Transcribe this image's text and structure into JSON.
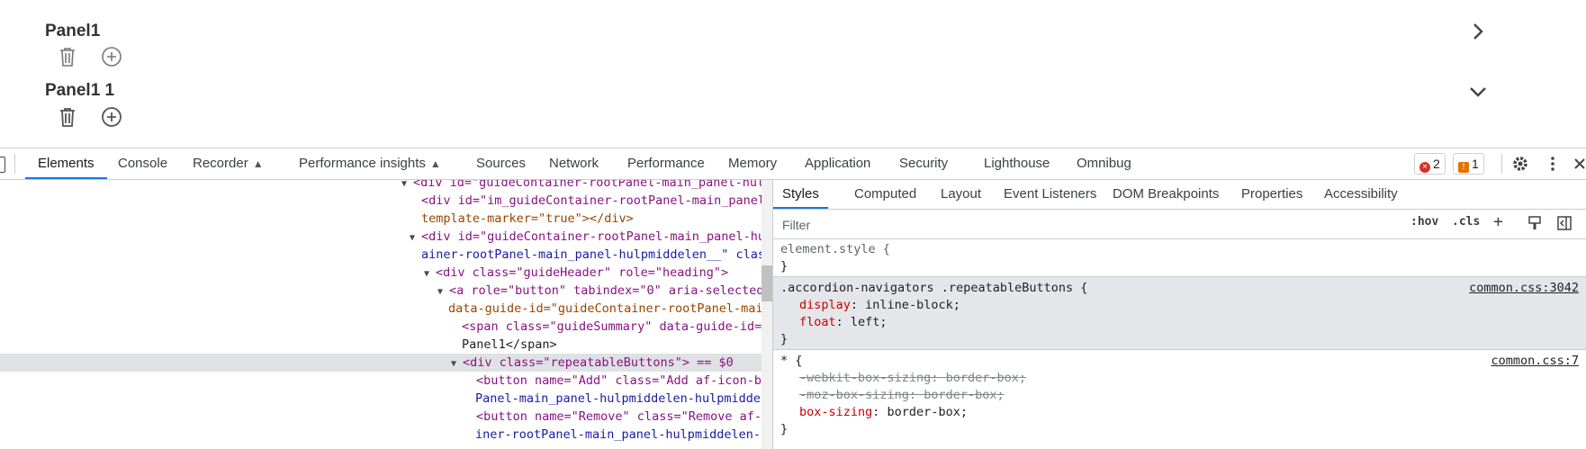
{
  "page": {
    "panels": [
      {
        "title": "Panel1",
        "nav_icon": "chevron-right-icon"
      },
      {
        "title": "Panel1 1",
        "nav_icon": "chevron-down-icon"
      }
    ],
    "button_icons": [
      "trash-icon",
      "add-circle-icon"
    ]
  },
  "devtools": {
    "tabs": [
      {
        "label": "Elements",
        "active": true
      },
      {
        "label": "Console"
      },
      {
        "label": "Recorder",
        "experimental": true
      },
      {
        "label": "Performance insights",
        "experimental": true
      },
      {
        "label": "Sources"
      },
      {
        "label": "Network"
      },
      {
        "label": "Performance"
      },
      {
        "label": "Memory"
      },
      {
        "label": "Application"
      },
      {
        "label": "Security"
      },
      {
        "label": "Lighthouse"
      },
      {
        "label": "Omnibug"
      }
    ],
    "error_count": "2",
    "warning_count": "1",
    "toolbar_icons": [
      "settings-icon",
      "more-vert-icon",
      "close-icon"
    ],
    "tree": [
      "<div id=\"guideContainer-rootPanel-main_panel-hulp",
      "<div id=\"im_guideContainer-rootPanel-main_panel",
      "template-marker=\"true\"></div>",
      "<div id=\"guideContainer-rootPanel-main_panel-hu",
      "ainer-rootPanel-main_panel-hulpmiddelen__\" clas",
      "<div class=\"guideHeader\" role=\"heading\">",
      "<a role=\"button\" tabindex=\"0\" aria-selected",
      "data-guide-id=\"guideContainer-rootPanel-mai",
      "<span class=\"guideSummary\" data-guide-id=",
      "Panel1</span>",
      "<div class=\"repeatableButtons\"> == $0",
      "<button name=\"Add\" class=\"Add af-icon-bu",
      "Panel-main_panel-hulpmiddelen-hulpmiddel",
      "<button name=\"Remove\" class=\"Remove af-i",
      "iner-rootPanel-main_panel-hulpmiddelen-h"
    ],
    "styles_tabs": [
      "Styles",
      "Computed",
      "Layout",
      "Event Listeners",
      "DOM Breakpoints",
      "Properties",
      "Accessibility"
    ],
    "filter_placeholder": "Filter",
    "hov_label": ":hov",
    "cls_label": ".cls",
    "rules": {
      "element_style": {
        "selector": "element.style {",
        "close": "}"
      },
      "rule1": {
        "selector": ".accordion-navigators .repeatableButtons {",
        "source": "common.css:3042",
        "props": [
          {
            "name": "display",
            "value": "inline-block;"
          },
          {
            "name": "float",
            "value": "left;"
          }
        ],
        "close": "}"
      },
      "rule2": {
        "selector": "* {",
        "source": "common.css:7",
        "props": [
          {
            "name": "-webkit-box-sizing",
            "value": "border-box;",
            "overridden": true
          },
          {
            "name": "-moz-box-sizing",
            "value": "border-box;",
            "overridden": true
          },
          {
            "name": "box-sizing",
            "value": "border-box;"
          }
        ],
        "close": "}"
      }
    }
  }
}
